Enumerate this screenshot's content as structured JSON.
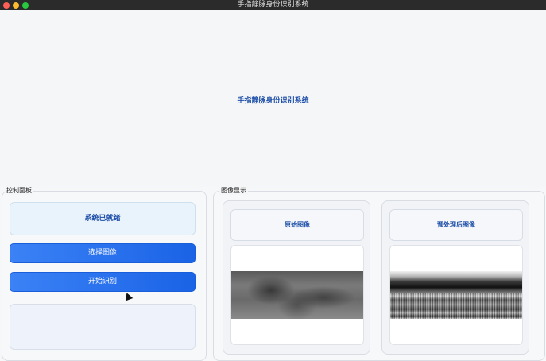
{
  "window": {
    "title": "手指静脉身份识别系统"
  },
  "header": {
    "title": "手指静脉身份识别系统"
  },
  "control_panel": {
    "label": "控制面板",
    "status": "系统已就绪",
    "select_button": "选择图像",
    "start_button": "开始识别"
  },
  "image_display": {
    "label": "图像显示",
    "original_title": "原始图像",
    "processed_title": "预处理后图像"
  },
  "colors": {
    "accent": "#1a63e6",
    "title_text": "#1e4fa8"
  }
}
